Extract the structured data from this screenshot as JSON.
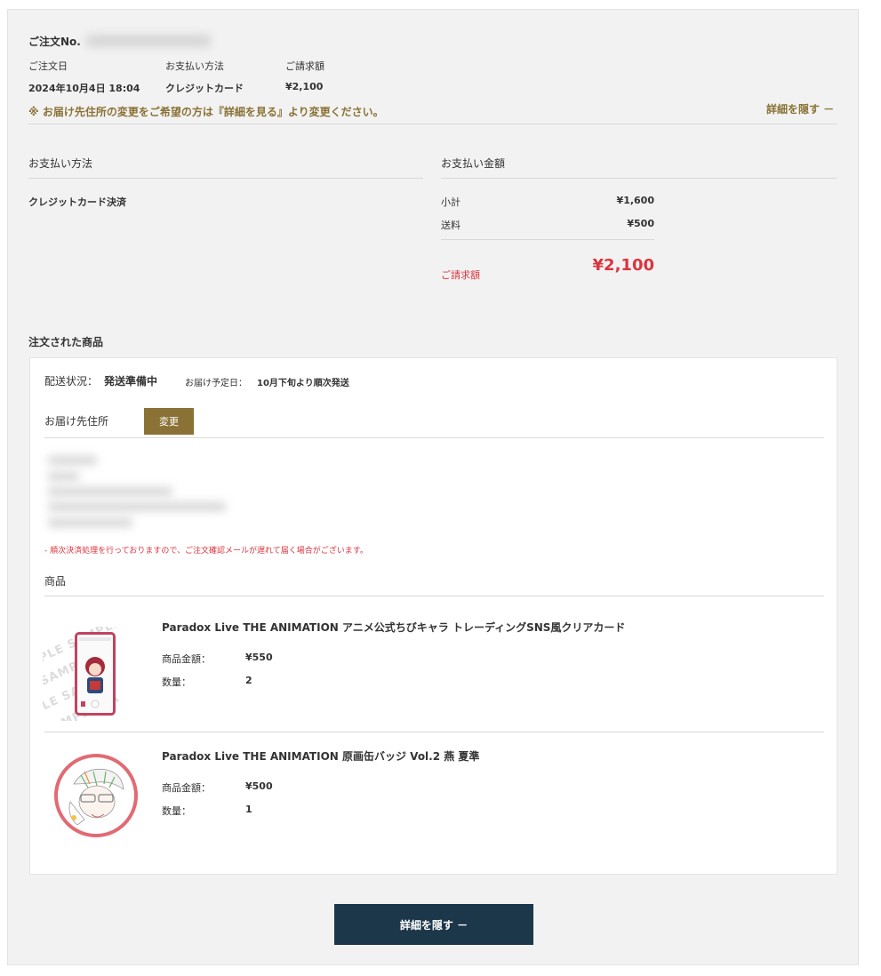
{
  "order": {
    "number_label": "ご注文No.",
    "date_label": "ご注文日",
    "payment_method_label": "お支払い方法",
    "billing_label": "ご請求額",
    "date_value": "2024年10月4日 18:04",
    "payment_method_value": "クレジットカード",
    "billing_value": "¥2,100",
    "notice": "※ お届け先住所の変更をご希望の方は『詳細を見る』より変更ください。",
    "hide_details_link": "詳細を隠す －"
  },
  "payment": {
    "method_heading": "お支払い方法",
    "method_value": "クレジットカード決済",
    "amount_heading": "お支払い金額",
    "subtotal_label": "小計",
    "subtotal_value": "¥1,600",
    "shipping_label": "送料",
    "shipping_value": "¥500",
    "total_label": "ご請求額",
    "total_value": "¥2,100"
  },
  "items_section": {
    "heading": "注文された商品",
    "shipping_status_label": "配送状況：",
    "shipping_status_value": "発送準備中",
    "delivery_date_label": "お届け予定日：",
    "delivery_date_value": "10月下旬より順次発送",
    "address_label": "お届け先住所",
    "change_button": "変更",
    "warning": "- 順次決済処理を行っておりますので、ご注文確認メールが遅れて届く場合がございます。",
    "products_heading": "商品",
    "price_label": "商品金額：",
    "quantity_label": "数量：",
    "products": [
      {
        "name": "Paradox Live THE ANIMATION アニメ公式ちびキャラ トレーディングSNS風クリアカード",
        "price": "¥550",
        "quantity": "2"
      },
      {
        "name": "Paradox Live THE ANIMATION 原画缶バッジ Vol.2 燕 夏準",
        "price": "¥500",
        "quantity": "1"
      }
    ]
  },
  "footer": {
    "hide_details_button": "詳細を隠す －"
  },
  "colors": {
    "panel_bg": "#f2f2f2",
    "gold": "#8a7236",
    "red": "#d9353f",
    "navy": "#1c364a"
  }
}
